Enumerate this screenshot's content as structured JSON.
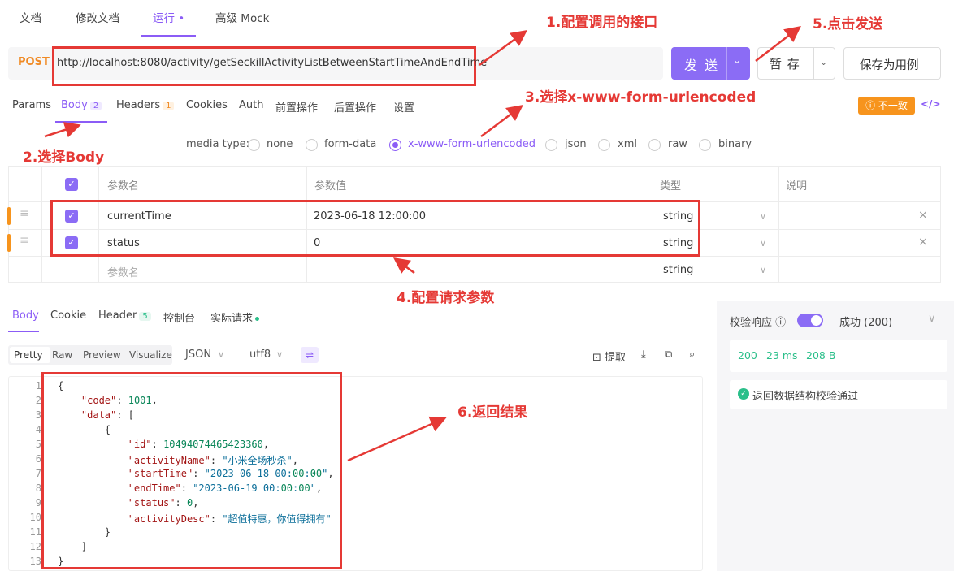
{
  "top_tabs": [
    "文档",
    "修改文档",
    "运行 •",
    "高级 Mock"
  ],
  "request": {
    "method": "POST",
    "url": "http://localhost:8080/activity/getSeckillActivityListBetweenStartTimeAndEndTime",
    "send_label": "发 送",
    "save_label": "暂 存",
    "save_case_label": "保存为用例"
  },
  "req_tabs": {
    "params": "Params",
    "body": "Body",
    "body_count": "2",
    "headers": "Headers",
    "headers_count": "1",
    "cookies": "Cookies",
    "auth": "Auth",
    "pre": "前置操作",
    "post": "后置操作",
    "settings": "设置",
    "inconsistent": "ⓘ 不一致",
    "code_icon": "</>"
  },
  "media": {
    "label": "media type:",
    "options": [
      "none",
      "form-data",
      "x-www-form-urlencoded",
      "json",
      "xml",
      "raw",
      "binary"
    ],
    "selected": "x-www-form-urlencoded"
  },
  "params_table": {
    "headers": {
      "name": "参数名",
      "value": "参数值",
      "type": "类型",
      "desc": "说明"
    },
    "rows": [
      {
        "name": "currentTime",
        "value": "2023-06-18 12:00:00",
        "type": "string"
      },
      {
        "name": "status",
        "value": "0",
        "type": "string"
      }
    ],
    "new_row": {
      "name_placeholder": "参数名",
      "type": "string"
    }
  },
  "response_tabs": {
    "body": "Body",
    "cookie": "Cookie",
    "header": "Header",
    "header_count": "5",
    "console": "控制台",
    "actual": "实际请求"
  },
  "view_modes": [
    "Pretty",
    "Raw",
    "Preview",
    "Visualize"
  ],
  "format": {
    "type": "JSON",
    "encoding": "utf8"
  },
  "tools": {
    "extract": "提取"
  },
  "code_lines": [
    "{",
    "    \"code\": 1001,",
    "    \"data\": [",
    "        {",
    "            \"id\": 10494074465423360,",
    "            \"activityName\": \"小米全场秒杀\",",
    "            \"startTime\": \"2023-06-18 00:00:00\",",
    "            \"endTime\": \"2023-06-19 00:00:00\",",
    "            \"status\": 0,",
    "            \"activityDesc\": \"超值特惠，你值得拥有\"",
    "        }",
    "    ]",
    "}"
  ],
  "right_panel": {
    "validate_label": "校验响应 ⓘ",
    "status_option": "成功 (200)",
    "status_code": "200",
    "time": "23 ms",
    "size": "208 B",
    "validation_msg": "返回数据结构校验通过"
  },
  "annotations": {
    "a1": "1.配置调用的接口",
    "a2": "2.选择Body",
    "a3": "3.选择x-www-form-urlencoded",
    "a4": "4.配置请求参数",
    "a5": "5.点击发送",
    "a6": "6.返回结果"
  },
  "colors": {
    "accent": "#8b5cf6",
    "annotation": "#e53935",
    "method": "#f08a24",
    "success": "#2bbf8a"
  }
}
